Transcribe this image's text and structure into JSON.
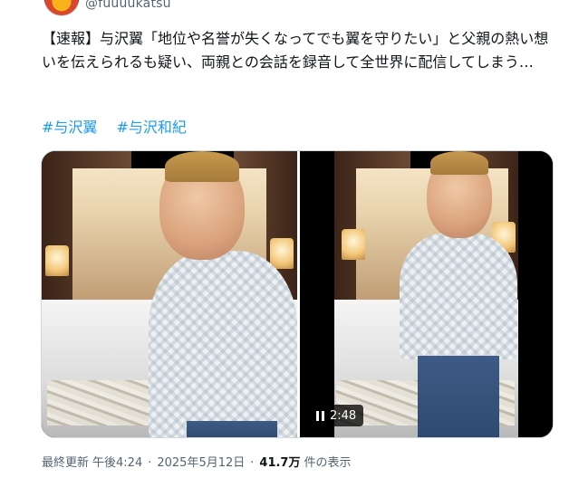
{
  "author": {
    "handle": "@fuuuukatsu"
  },
  "tweet": {
    "text": "【速報】与沢翼「地位や名誉が失くなってでも翼を守りたい」と父親の熱い想いを伝えられるも疑い、両親との会話を録音して全世界に配信してしまう…",
    "hashtags": [
      "#与沢翼",
      "#与沢和紀"
    ]
  },
  "media": {
    "video_duration": "2:48",
    "play_state_icon": "pause-icon"
  },
  "footer": {
    "prefix": "最終更新",
    "time": "午後4:24",
    "separator": "·",
    "date": "2025年5月12日",
    "separator2": "·",
    "views_count": "41.7万",
    "views_label": "件の表示"
  },
  "colors": {
    "link": "#1d9bf0",
    "text": "#0f1419",
    "secondary": "#536471"
  }
}
